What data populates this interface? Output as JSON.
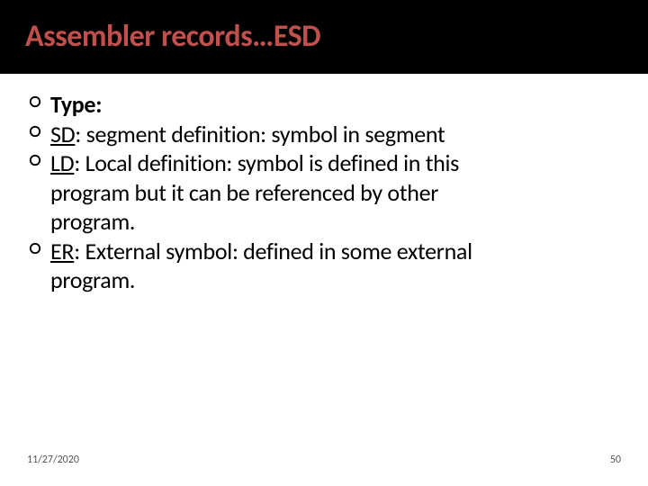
{
  "title": "Assembler records…ESD",
  "bullets": {
    "type_label": "Type:",
    "sd_label": "SD",
    "sd_rest": ": segment definition: symbol in segment",
    "ld_label": "LD",
    "ld_rest": ": Local definition: symbol is defined in this",
    "ld_cont1": "program but it can be referenced by other",
    "ld_cont2": "program.",
    "er_label": "ER",
    "er_rest": ": External symbol: defined in some external",
    "er_cont1": "program."
  },
  "footer": {
    "date": "11/27/2020",
    "page": "50"
  },
  "colors": {
    "title": "#C0504D",
    "titlebar_bg": "#000000"
  }
}
